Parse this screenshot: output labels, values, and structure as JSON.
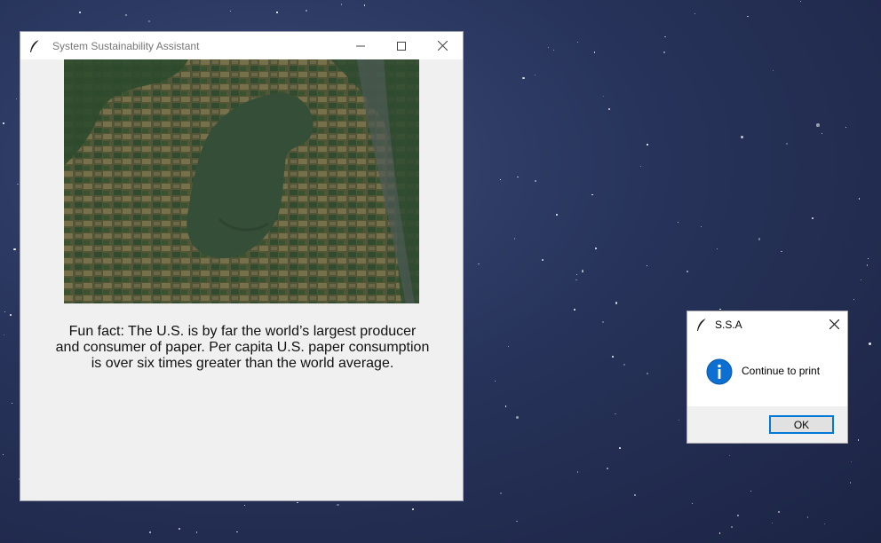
{
  "main_window": {
    "title": "System Sustainability Assistant",
    "controls": {
      "minimize": "minimize-icon",
      "maximize": "maximize-icon",
      "close": "close-icon"
    },
    "fact_lines": [
      "Fun fact: The U.S. is by far the world’s largest producer",
      "and consumer of paper. Per capita U.S. paper consumption",
      "is over six times greater than the world average."
    ]
  },
  "dialog": {
    "title": "S.S.A",
    "message": "Continue to print",
    "ok_label": "OK",
    "icon": "info-icon",
    "accent": "#0078d7"
  }
}
